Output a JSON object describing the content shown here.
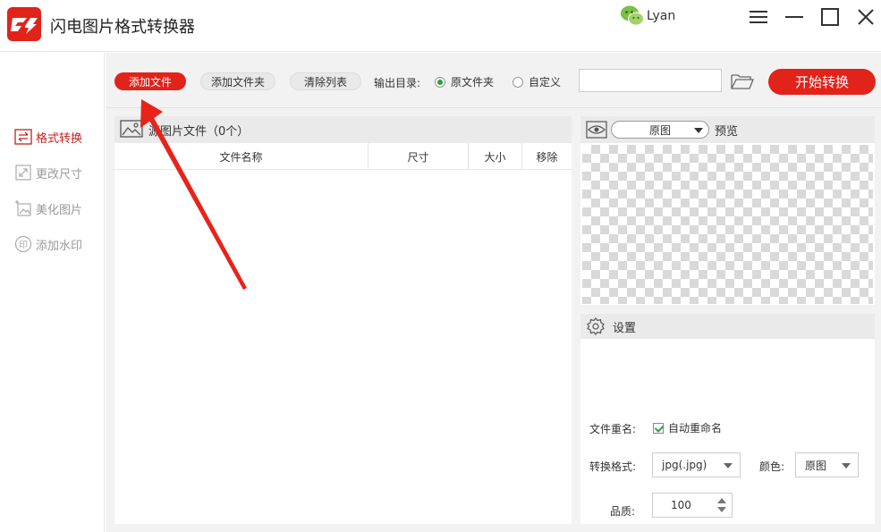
{
  "app": {
    "title": "闪电图片格式转换器"
  },
  "user": {
    "name": "Lyan"
  },
  "sidebar": {
    "items": [
      {
        "label": "格式转换",
        "icon": "swap-icon",
        "active": true
      },
      {
        "label": "更改尺寸",
        "icon": "resize-icon",
        "active": false
      },
      {
        "label": "美化图片",
        "icon": "beautify-icon",
        "active": false
      },
      {
        "label": "添加水印",
        "icon": "watermark-icon",
        "active": false
      }
    ]
  },
  "toolbar": {
    "add_file": "添加文件",
    "add_folder": "添加文件夹",
    "clear_list": "清除列表",
    "output_label": "输出目录:",
    "radio_original": "原文件夹",
    "radio_custom": "自定义",
    "path_value": "",
    "start": "开始转换"
  },
  "file_panel": {
    "title": "源图片文件（0个）",
    "columns": [
      "文件名称",
      "尺寸",
      "大小",
      "移除"
    ]
  },
  "preview": {
    "mode_value": "原图",
    "label": "预览"
  },
  "settings": {
    "title": "设置",
    "rename_label": "文件重名:",
    "auto_rename": "自动重命名",
    "format_label": "转换格式:",
    "format_value": "jpg(.jpg)",
    "color_label": "颜色:",
    "color_value": "原图",
    "quality_label": "品质:",
    "quality_value": "100"
  },
  "colors": {
    "accent": "#e2231a",
    "check": "#2e9e3f",
    "active_nav": "#c4211a"
  }
}
